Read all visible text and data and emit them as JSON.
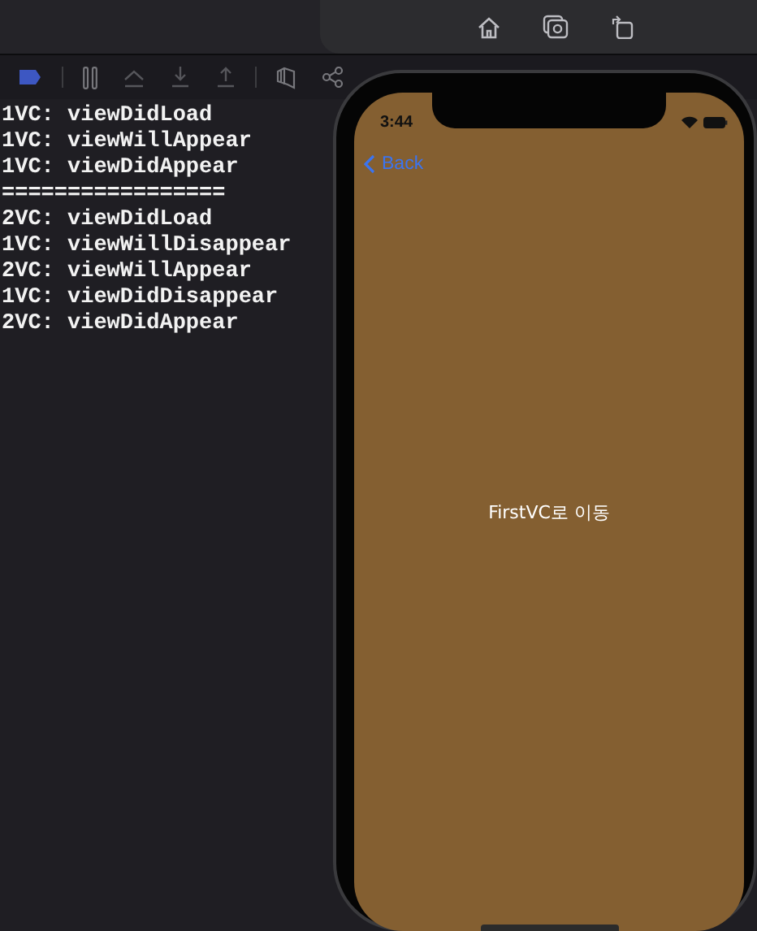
{
  "console": {
    "lines": [
      "1VC: viewDidLoad",
      "1VC: viewWillAppear",
      "1VC: viewDidAppear",
      "=================",
      "2VC: viewDidLoad",
      "1VC: viewWillDisappear",
      "2VC: viewWillAppear",
      "1VC: viewDidDisappear",
      "2VC: viewDidAppear"
    ]
  },
  "simulator": {
    "status_bar": {
      "time": "3:44"
    },
    "nav_bar": {
      "back": "Back"
    },
    "label": "FirstVC로 이동"
  }
}
